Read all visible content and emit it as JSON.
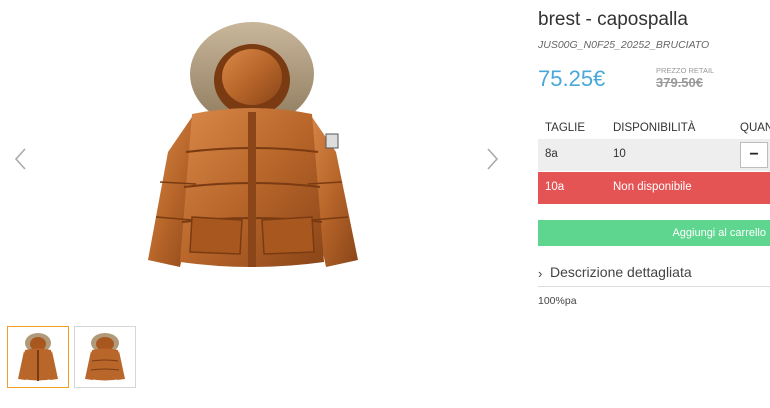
{
  "product": {
    "title": "brest - capospalla",
    "sku": "JUS00G_N0F25_20252_BRUCIATO",
    "price": "75.25€",
    "retail_label": "PREZZO RETAIL",
    "retail_price": "379.50€"
  },
  "sizes_table": {
    "headers": [
      "TAGLIE",
      "DISPONIBILITÀ",
      "QUAN"
    ],
    "rows": [
      {
        "size": "8a",
        "availability": "10",
        "qty_button": "−"
      },
      {
        "size": "10a",
        "availability": "Non disponibile"
      }
    ]
  },
  "cart_button": {
    "label": "Aggiungi al carrello"
  },
  "description": {
    "toggle_label": "Descrizione dettagliata",
    "chevron": "›",
    "text": "100%pa"
  },
  "gallery": {
    "prev_icon": "chevron-left",
    "next_icon": "chevron-right",
    "thumbnails": [
      "jacket-front-thumb",
      "jacket-back-thumb"
    ],
    "active_thumb": 0
  },
  "colors": {
    "price": "#4aa8d8",
    "unavailable_row": "#e55454",
    "cart_button": "#5ed68f",
    "active_thumb_border": "#f0a020",
    "jacket": "#b8662a"
  }
}
